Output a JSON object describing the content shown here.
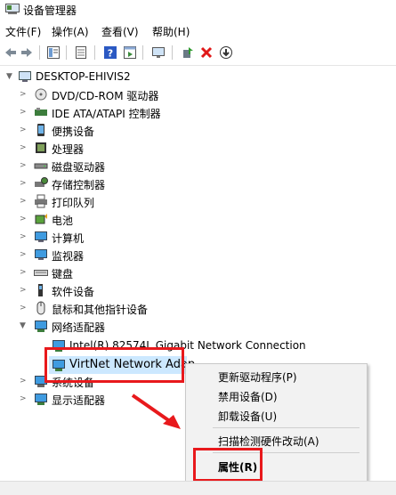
{
  "window": {
    "title": "设备管理器",
    "icon": "device-manager-icon"
  },
  "menubar": [
    {
      "label": "文件(F)"
    },
    {
      "label": "操作(A)"
    },
    {
      "label": "查看(V)"
    },
    {
      "label": "帮助(H)"
    }
  ],
  "toolbar": [
    "back-arrow-icon",
    "forward-arrow-icon",
    "properties-icon",
    "list-icon",
    "help-icon",
    "refresh-pane-icon",
    "monitor-icon",
    "update-driver-icon",
    "uninstall-x-icon",
    "download-icon"
  ],
  "tree": {
    "root": "DESKTOP-EHIVIS2",
    "categories": [
      {
        "label": "DVD/CD-ROM 驱动器",
        "icon": "dvd-drive-icon"
      },
      {
        "label": "IDE ATA/ATAPI 控制器",
        "icon": "ide-controller-icon"
      },
      {
        "label": "便携设备",
        "icon": "portable-device-icon"
      },
      {
        "label": "处理器",
        "icon": "processor-icon"
      },
      {
        "label": "磁盘驱动器",
        "icon": "disk-drive-icon"
      },
      {
        "label": "存储控制器",
        "icon": "storage-controller-icon"
      },
      {
        "label": "打印队列",
        "icon": "printer-icon"
      },
      {
        "label": "电池",
        "icon": "battery-icon"
      },
      {
        "label": "计算机",
        "icon": "computer-icon"
      },
      {
        "label": "监视器",
        "icon": "monitor-icon"
      },
      {
        "label": "键盘",
        "icon": "keyboard-icon"
      },
      {
        "label": "软件设备",
        "icon": "software-device-icon"
      },
      {
        "label": "鼠标和其他指针设备",
        "icon": "mouse-icon"
      },
      {
        "label": "网络适配器",
        "icon": "network-adapter-icon"
      }
    ],
    "network_children": [
      {
        "label": "Intel(R) 82574L Gigabit Network Connection",
        "icon": "network-adapter-icon"
      },
      {
        "label": "VirtNet Network Adapter",
        "icon": "network-adapter-icon",
        "visible_text": "VirtNet Network Adap"
      }
    ],
    "after": [
      {
        "label": "系统设备",
        "icon": "system-device-icon"
      },
      {
        "label": "显示适配器",
        "icon": "display-adapter-icon"
      }
    ]
  },
  "context_menu": {
    "items": [
      {
        "label": "更新驱动程序(P)"
      },
      {
        "label": "禁用设备(D)"
      },
      {
        "label": "卸载设备(U)"
      },
      {
        "label": "扫描检测硬件改动(A)"
      },
      {
        "label": "属性(R)"
      }
    ]
  },
  "colors": {
    "selection": "#cce8ff",
    "highlight_box": "#e8191c",
    "menu_bg": "#f2f2f2"
  }
}
